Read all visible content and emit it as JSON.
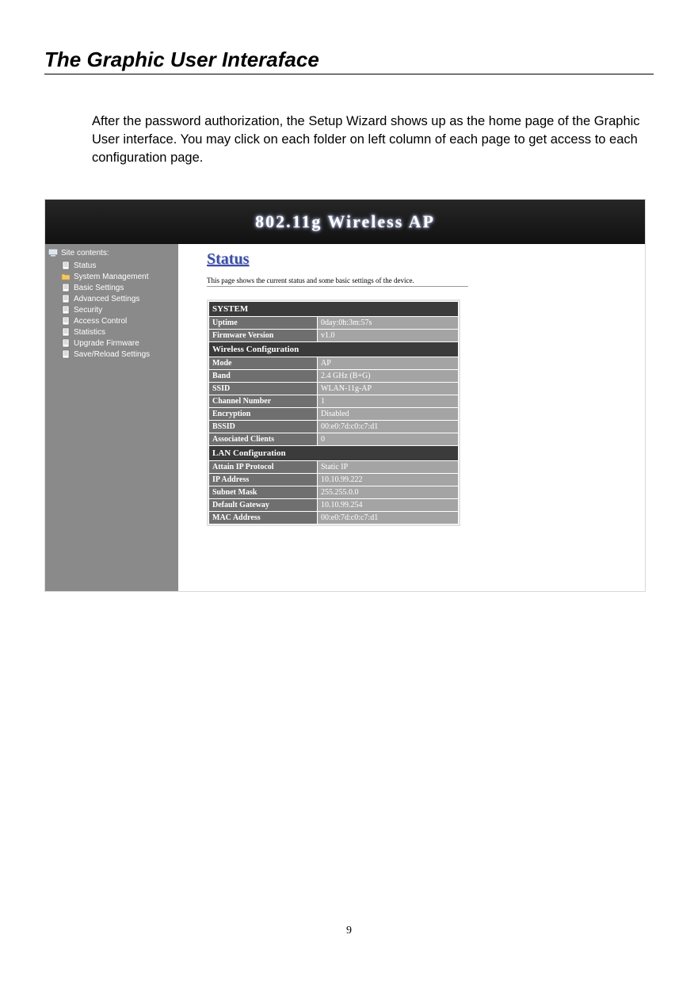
{
  "doc": {
    "title": "The Graphic User Interaface",
    "intro": "After the password authorization, the Setup Wizard shows up as the home page of the Graphic User interface. You may click on each folder on left column of each page to get access to each configuration page.",
    "page_number": "9"
  },
  "banner": {
    "title": "802.11g  Wireless  AP"
  },
  "sidebar": {
    "root_label": "Site contents:",
    "items": [
      {
        "label": "Status",
        "icon": "page"
      },
      {
        "label": "System Management",
        "icon": "folder"
      },
      {
        "label": "Basic Settings",
        "icon": "page"
      },
      {
        "label": "Advanced Settings",
        "icon": "page"
      },
      {
        "label": "Security",
        "icon": "page"
      },
      {
        "label": "Access Control",
        "icon": "page"
      },
      {
        "label": "Statistics",
        "icon": "page"
      },
      {
        "label": "Upgrade Firmware",
        "icon": "page"
      },
      {
        "label": "Save/Reload Settings",
        "icon": "page"
      }
    ]
  },
  "status": {
    "heading": "Status",
    "description": "This page shows the current status and some basic settings of the device.",
    "sections": [
      {
        "title": "SYSTEM",
        "rows": [
          {
            "key": "Uptime",
            "val": "0day:0h:3m:57s"
          },
          {
            "key": "Firmware Version",
            "val": "v1.0"
          }
        ]
      },
      {
        "title": "Wireless Configuration",
        "rows": [
          {
            "key": "Mode",
            "val": "AP"
          },
          {
            "key": "Band",
            "val": "2.4 GHz (B+G)"
          },
          {
            "key": "SSID",
            "val": "WLAN-11g-AP"
          },
          {
            "key": "Channel Number",
            "val": "1"
          },
          {
            "key": "Encryption",
            "val": "Disabled"
          },
          {
            "key": "BSSID",
            "val": "00:e0:7d:c0:c7:d1"
          },
          {
            "key": "Associated Clients",
            "val": "0"
          }
        ]
      },
      {
        "title": "LAN Configuration",
        "rows": [
          {
            "key": "Attain IP Protocol",
            "val": "Static IP"
          },
          {
            "key": "IP Address",
            "val": "10.10.99.222"
          },
          {
            "key": "Subnet Mask",
            "val": "255.255.0.0"
          },
          {
            "key": "Default Gateway",
            "val": "10.10.99.254"
          },
          {
            "key": "MAC Address",
            "val": "00:e0:7d:c0:c7:d1"
          }
        ]
      }
    ]
  }
}
